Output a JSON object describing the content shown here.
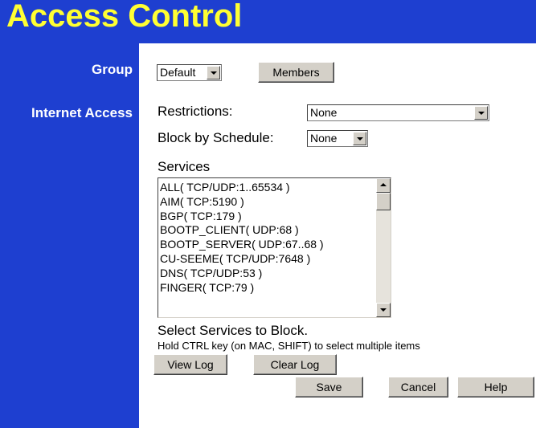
{
  "header": {
    "title": "Access Control"
  },
  "sidebar": {
    "group_label": "Group",
    "internet_access_label": "Internet Access"
  },
  "group": {
    "selected": "Default",
    "members_button": "Members"
  },
  "restrictions": {
    "label": "Restrictions:",
    "selected": "None"
  },
  "schedule": {
    "label": "Block by Schedule:",
    "selected": "None"
  },
  "services": {
    "label": "Services",
    "items": [
      "ALL( TCP/UDP:1..65534 )",
      "AIM( TCP:5190 )",
      "BGP( TCP:179 )",
      "BOOTP_CLIENT( UDP:68 )",
      "BOOTP_SERVER( UDP:67..68 )",
      "CU-SEEME( TCP/UDP:7648 )",
      "DNS( TCP/UDP:53 )",
      "FINGER( TCP:79 )"
    ],
    "instruction": "Select Services to Block.",
    "hint": "Hold CTRL key (on MAC, SHIFT) to select multiple items"
  },
  "buttons": {
    "view_log": "View Log",
    "clear_log": "Clear Log",
    "save": "Save",
    "cancel": "Cancel",
    "help": "Help"
  },
  "colors": {
    "sidebar_bg": "#1e3fd0",
    "title_color": "#ffff33",
    "button_face": "#d4d0c8"
  }
}
